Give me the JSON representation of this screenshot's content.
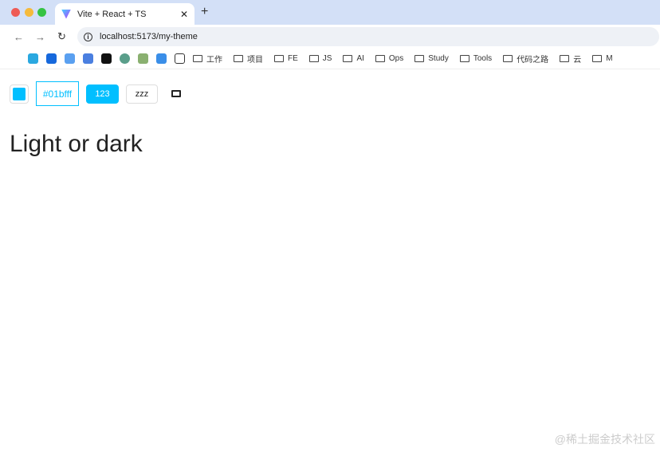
{
  "browser": {
    "tab_title": "Vite + React + TS",
    "url": "localhost:5173/my-theme",
    "bookmark_folders": [
      "工作",
      "项目",
      "FE",
      "JS",
      "AI",
      "Ops",
      "Study",
      "Tools",
      "代码之路",
      "云",
      "M"
    ]
  },
  "toolbar": {
    "color": "#01bfff",
    "hex_value": "#01bfff",
    "primary_button": "123",
    "default_button": "zzz"
  },
  "page": {
    "heading": "Light or dark"
  },
  "watermark": "@稀土掘金技术社区"
}
